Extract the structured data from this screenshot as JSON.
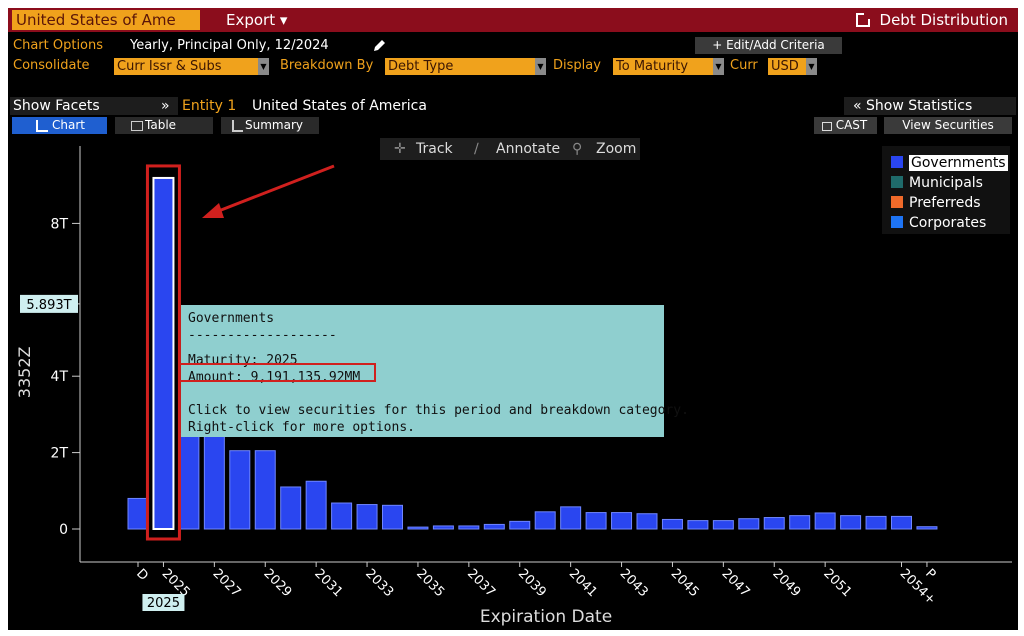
{
  "header": {
    "entity": "United States of Ame",
    "export_label": "Export ▾",
    "app_title": "Debt Distribution"
  },
  "options": {
    "chart_options_label": "Chart Options",
    "chart_options_value": "Yearly, Principal Only, 12/2024",
    "edit_criteria_label": "+ Edit/Add Criteria",
    "consolidate_label": "Consolidate",
    "consolidate_value": "Curr Issr & Subs",
    "breakdown_label": "Breakdown By",
    "breakdown_value": "Debt Type",
    "display_label": "Display",
    "display_value": "To Maturity",
    "curr_label": "Curr",
    "curr_value": "USD"
  },
  "facets": {
    "show_facets_label": "Show Facets",
    "collapse_glyph": "»",
    "entity_label": "Entity 1",
    "entity_value": "United States of America",
    "show_statistics_label": "« Show Statistics"
  },
  "tabs": {
    "chart": "Chart",
    "table": "Table",
    "summary": "Summary",
    "cast": "CAST",
    "view_securities": "View Securities"
  },
  "toolbar": {
    "track": "Track",
    "annotate": "Annotate",
    "zoom": "Zoom"
  },
  "tooltip": {
    "series": "Governments",
    "divider": "-------------------",
    "maturity": "Maturity: 2025",
    "amount": "Amount: 9,191,135.92MM",
    "hint1": "Click to view securities for this period and breakdown category.",
    "hint2": "Right-click for more options."
  },
  "colors": {
    "governments": "#2a46f0",
    "municipals": "#1f6b6b",
    "preferreds": "#f06a2a",
    "corporates": "#1e74f5",
    "highlight": "#d0201e",
    "tooltip_bg": "#8fcfcf",
    "accent": "#f0a21c"
  },
  "chart_data": {
    "type": "bar",
    "xlabel": "Expiration Date",
    "ylabel": "3352Z",
    "ylim": [
      0,
      9.5
    ],
    "y_unit": "T",
    "y_ticks": [
      "0",
      "2T",
      "4T",
      "8T"
    ],
    "y_tick_values": [
      0,
      2,
      4,
      8
    ],
    "crosshair_label": "5.893T",
    "crosshair_value": 5.893,
    "selected_label": "2025",
    "categories": [
      "D",
      "2025",
      "2026",
      "2027",
      "2028",
      "2029",
      "2030",
      "2031",
      "2032",
      "2033",
      "2034",
      "2035",
      "2036",
      "2037",
      "2038",
      "2039",
      "2040",
      "2041",
      "2042",
      "2043",
      "2044",
      "2045",
      "2046",
      "2047",
      "2048",
      "2049",
      "2050",
      "2051",
      "2052",
      "2053",
      "2054+",
      "P"
    ],
    "x_tick_labels": [
      "D",
      "2025",
      "2027",
      "2029",
      "2031",
      "2033",
      "2035",
      "2037",
      "2039",
      "2041",
      "2043",
      "2045",
      "2047",
      "2049",
      "2051",
      "2054+",
      "P"
    ],
    "series": [
      {
        "name": "Governments",
        "values": [
          0.8,
          9.19,
          2.5,
          2.5,
          2.05,
          2.05,
          1.1,
          1.25,
          0.68,
          0.64,
          0.62,
          0.05,
          0.08,
          0.08,
          0.12,
          0.2,
          0.45,
          0.58,
          0.43,
          0.43,
          0.4,
          0.25,
          0.22,
          0.22,
          0.27,
          0.3,
          0.35,
          0.42,
          0.35,
          0.33,
          0.33,
          0.06
        ]
      }
    ],
    "legend": [
      "Governments",
      "Municipals",
      "Preferreds",
      "Corporates"
    ],
    "legend_position": "top-right",
    "grid": false
  }
}
